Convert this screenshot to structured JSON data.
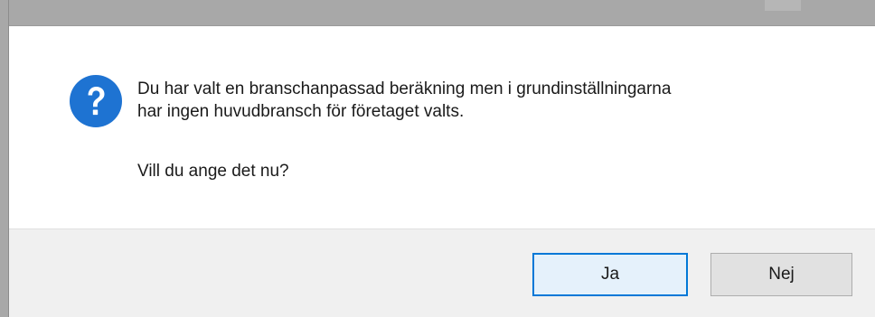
{
  "dialog": {
    "icon": "question-icon",
    "accent_color": "#1e73d2",
    "message_lines": [
      "Du har valt en branschanpassad beräkning men i grundinställningarna",
      "har ingen huvudbransch för företaget valts."
    ],
    "question": "Vill du ange det nu?",
    "buttons": {
      "yes_label": "Ja",
      "no_label": "Nej"
    }
  }
}
